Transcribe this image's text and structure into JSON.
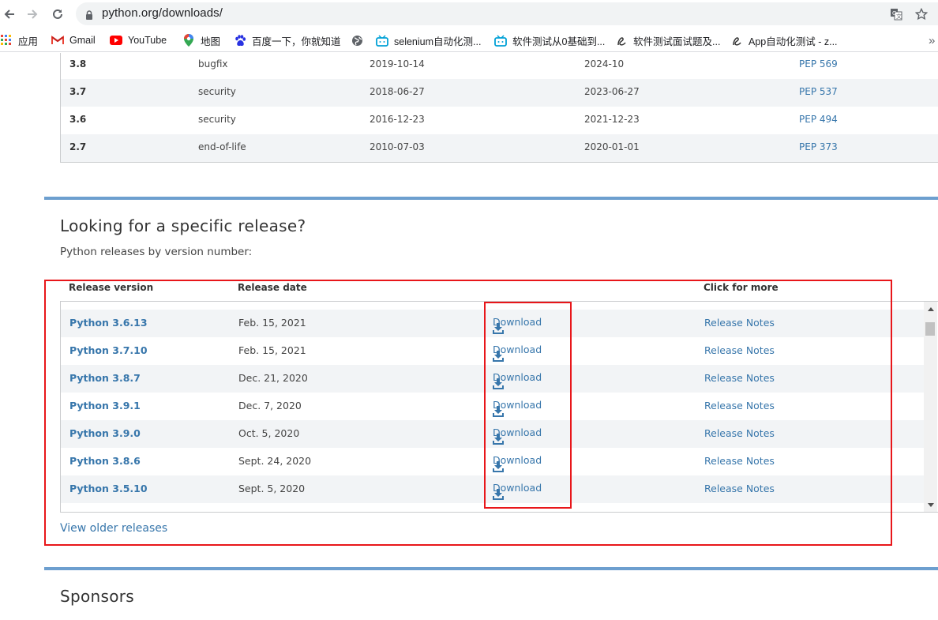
{
  "browser": {
    "url": "python.org/downloads/",
    "bookmarks": [
      {
        "label": "应用",
        "icon": "apps-grid-icon"
      },
      {
        "label": "Gmail",
        "icon": "gmail-icon"
      },
      {
        "label": "YouTube",
        "icon": "youtube-icon"
      },
      {
        "label": "地图",
        "icon": "maps-pin-icon"
      },
      {
        "label": "百度一下，你就知道",
        "icon": "baidu-paw-icon"
      },
      {
        "label": "",
        "icon": "globe-icon"
      },
      {
        "label": "selenium自动化测...",
        "icon": "bilibili-tv-icon"
      },
      {
        "label": "软件测试从0基础到...",
        "icon": "bilibili-tv-icon"
      },
      {
        "label": "软件测试面试题及...",
        "icon": "script-logo-icon"
      },
      {
        "label": "App自动化测试 - z...",
        "icon": "script-logo-icon"
      }
    ],
    "more_label": "»"
  },
  "top_table": {
    "rows": [
      {
        "version": "3.8",
        "status": "bugfix",
        "first_released": "2019-10-14",
        "end_of_support": "2024-10",
        "pep": "PEP 569"
      },
      {
        "version": "3.7",
        "status": "security",
        "first_released": "2018-06-27",
        "end_of_support": "2023-06-27",
        "pep": "PEP 537"
      },
      {
        "version": "3.6",
        "status": "security",
        "first_released": "2016-12-23",
        "end_of_support": "2021-12-23",
        "pep": "PEP 494"
      },
      {
        "version": "2.7",
        "status": "end-of-life",
        "first_released": "2010-07-03",
        "end_of_support": "2020-01-01",
        "pep": "PEP 373"
      }
    ]
  },
  "releases_section": {
    "title": "Looking for a specific release?",
    "subtitle": "Python releases by version number:",
    "headers": {
      "version": "Release version",
      "date": "Release date",
      "more": "Click for more"
    },
    "rows": [
      {
        "version": "Python 3.6.13",
        "date": "Feb. 15, 2021",
        "download": "Download",
        "notes": "Release Notes"
      },
      {
        "version": "Python 3.7.10",
        "date": "Feb. 15, 2021",
        "download": "Download",
        "notes": "Release Notes"
      },
      {
        "version": "Python 3.8.7",
        "date": "Dec. 21, 2020",
        "download": "Download",
        "notes": "Release Notes"
      },
      {
        "version": "Python 3.9.1",
        "date": "Dec. 7, 2020",
        "download": "Download",
        "notes": "Release Notes"
      },
      {
        "version": "Python 3.9.0",
        "date": "Oct. 5, 2020",
        "download": "Download",
        "notes": "Release Notes"
      },
      {
        "version": "Python 3.8.6",
        "date": "Sept. 24, 2020",
        "download": "Download",
        "notes": "Release Notes"
      },
      {
        "version": "Python 3.5.10",
        "date": "Sept. 5, 2020",
        "download": "Download",
        "notes": "Release Notes"
      }
    ],
    "older_link": "View older releases"
  },
  "sponsors": {
    "title": "Sponsors"
  },
  "colors": {
    "link": "#3776ab",
    "divider": "#6d9fcf",
    "highlight_box": "#e8161a",
    "row_alt": "#f2f4f6"
  }
}
